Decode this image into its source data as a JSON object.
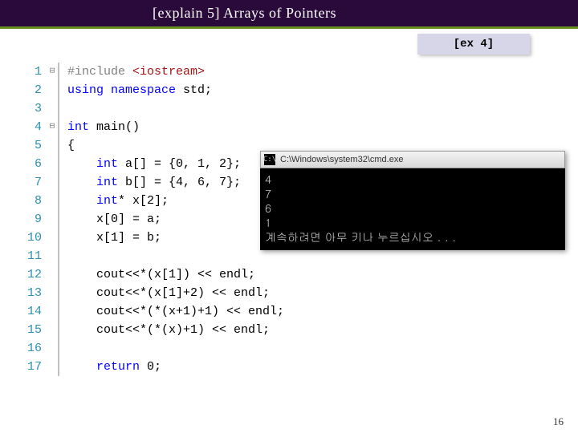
{
  "header": {
    "title": "[explain 5] Arrays of Pointers"
  },
  "badge": {
    "label": "[ex 4]"
  },
  "page_number": "16",
  "code": {
    "lines": [
      {
        "n": "1",
        "fold": "⊟",
        "pp": "#include ",
        "str": "<iostream>",
        "rest": ""
      },
      {
        "n": "2",
        "fold": "",
        "kw": "using",
        "mid": " ",
        "kw2": "namespace",
        "rest": " std;"
      },
      {
        "n": "3",
        "fold": "",
        "rest": ""
      },
      {
        "n": "4",
        "fold": "⊟",
        "kw": "int",
        "rest": " main()"
      },
      {
        "n": "5",
        "fold": "",
        "rest": "{"
      },
      {
        "n": "6",
        "fold": "",
        "indent": "    ",
        "kw": "int",
        "rest": " a[] = {0, 1, 2};"
      },
      {
        "n": "7",
        "fold": "",
        "indent": "    ",
        "kw": "int",
        "rest": " b[] = {4, 6, 7};"
      },
      {
        "n": "8",
        "fold": "",
        "indent": "    ",
        "kw": "int",
        "rest": "* x[2];"
      },
      {
        "n": "9",
        "fold": "",
        "indent": "    ",
        "rest": "x[0] = a;"
      },
      {
        "n": "10",
        "fold": "",
        "indent": "    ",
        "rest": "x[1] = b;"
      },
      {
        "n": "11",
        "fold": "",
        "rest": ""
      },
      {
        "n": "12",
        "fold": "",
        "indent": "    ",
        "rest": "cout<<*(x[1]) << endl;"
      },
      {
        "n": "13",
        "fold": "",
        "indent": "    ",
        "rest": "cout<<*(x[1]+2) << endl;"
      },
      {
        "n": "14",
        "fold": "",
        "indent": "    ",
        "rest": "cout<<*(*(x+1)+1) << endl;"
      },
      {
        "n": "15",
        "fold": "",
        "indent": "    ",
        "rest": "cout<<*(*(x)+1) << endl;"
      },
      {
        "n": "16",
        "fold": "",
        "rest": ""
      },
      {
        "n": "17",
        "fold": "",
        "indent": "    ",
        "kw": "return",
        "rest": " 0;"
      }
    ]
  },
  "console": {
    "title": "C:\\Windows\\system32\\cmd.exe",
    "lines": [
      "4",
      "7",
      "6",
      "1",
      "계속하려면 아무 키나 누르십시오 . . ."
    ]
  }
}
